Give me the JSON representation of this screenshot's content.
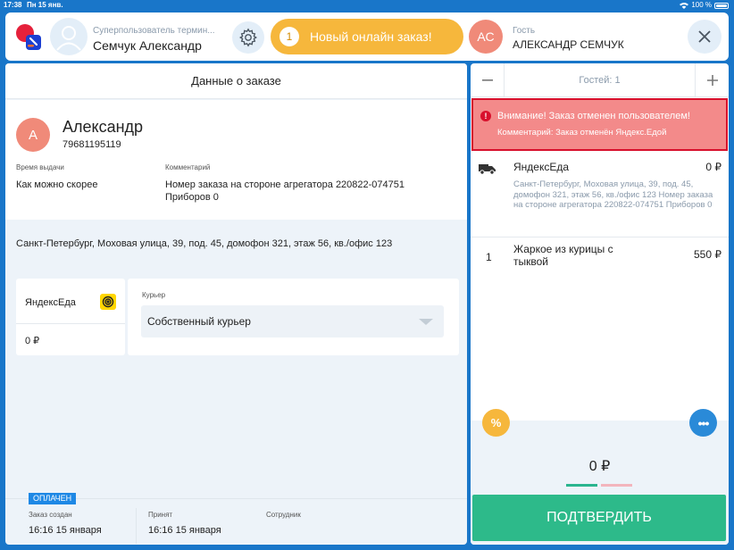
{
  "status_bar": {
    "time": "17:38",
    "date": "Пн 15 янв.",
    "battery": "100 %"
  },
  "header": {
    "user_role": "Суперпользователь термин...",
    "user_name": "Семчук Александр",
    "online_order_count": "1",
    "online_order_label": "Новый онлайн заказ!",
    "guest_initials": "АС",
    "guest_label": "Гость",
    "guest_name": "АЛЕКСАНДР СЕМЧУК"
  },
  "order": {
    "title": "Данные о заказе",
    "customer_initial": "А",
    "customer_name": "Александр",
    "customer_phone": "79681195119",
    "pickup_label": "Время выдачи",
    "pickup_value": "Как можно скорее",
    "comment_label": "Комментарий",
    "comment_value": "Номер заказа на стороне агрегатора 220822-074751 Приборов 0",
    "address": "Санкт-Петербург, Моховая улица, 39, под. 45, домофон 321, этаж 56, кв./офис 123",
    "aggregator_name": "ЯндексЕда",
    "aggregator_price": "0 ₽",
    "courier_label": "Курьер",
    "courier_value": "Собственный курьер",
    "paid_badge": "ОПЛАЧЕН",
    "created_label": "Заказ создан",
    "created_value": "16:16 15 января",
    "accepted_label": "Принят",
    "accepted_value": "16:16 15 января",
    "employee_label": "Сотрудник"
  },
  "cart": {
    "guests": "Гостей: 1",
    "alert_icon": "!",
    "alert_title": "Внимание! Заказ отменен пользователем!",
    "alert_comment": "Комментарий: Заказ отменён Яндекс.Едой",
    "delivery_name": "ЯндексЕда",
    "delivery_price": "0 ₽",
    "delivery_address": "Санкт-Петербург, Моховая улица, 39, под. 45, домофон 321, этаж 56, кв./офис 123 Номер заказа на стороне агрегатора 220822-074751 Приборов 0",
    "items": [
      {
        "qty": "1",
        "name": "Жаркое из курицы с тыквой",
        "price": "550 ₽"
      }
    ],
    "discount_icon": "%",
    "more_icon": "•••",
    "total": "0 ₽",
    "confirm_label": "ПОДТВЕРДИТЬ"
  },
  "colors": {
    "brand_blue": "#1976c9",
    "accent_orange": "#f6b73c",
    "confirm_green": "#2dba8a",
    "alert_red": "#d8102c"
  },
  "icons": [
    "app-logo-icon",
    "user-icon",
    "gear-icon",
    "close-icon",
    "minus-icon",
    "plus-icon",
    "alert-icon",
    "delivery-truck-icon",
    "yandex-eda-icon",
    "chevron-down-icon",
    "discount-icon",
    "more-icon",
    "wifi-icon",
    "battery-icon"
  ]
}
